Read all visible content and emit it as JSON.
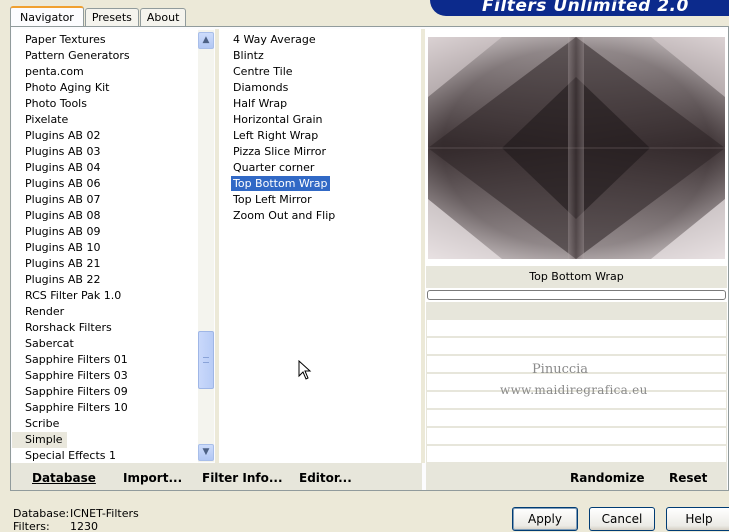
{
  "banner": {
    "title": "Filters Unlimited 2.0"
  },
  "tabs": [
    {
      "label": "Navigator",
      "active": true
    },
    {
      "label": "Presets",
      "active": false
    },
    {
      "label": "About",
      "active": false
    }
  ],
  "categories": {
    "items": [
      "Paper Textures",
      "Pattern Generators",
      "penta.com",
      "Photo Aging Kit",
      "Photo Tools",
      "Pixelate",
      "Plugins AB 02",
      "Plugins AB 03",
      "Plugins AB 04",
      "Plugins AB 06",
      "Plugins AB 07",
      "Plugins AB 08",
      "Plugins AB 09",
      "Plugins AB 10",
      "Plugins AB 21",
      "Plugins AB 22",
      "RCS Filter Pak 1.0",
      "Render",
      "Rorshack Filters",
      "Sabercat",
      "Sapphire Filters 01",
      "Sapphire Filters 03",
      "Sapphire Filters 09",
      "Sapphire Filters 10",
      "Scribe",
      "Simple",
      "Special Effects 1"
    ],
    "selected": "Simple"
  },
  "filters": {
    "items": [
      "4 Way Average",
      "Blintz",
      "Centre Tile",
      "Diamonds",
      "Half Wrap",
      "Horizontal Grain",
      "Left Right Wrap",
      "Pizza Slice Mirror",
      "Quarter corner",
      "Top Bottom Wrap",
      "Top Left Mirror",
      "Zoom Out and Flip"
    ],
    "selected": "Top Bottom Wrap"
  },
  "preview": {
    "filter_name": "Top Bottom Wrap"
  },
  "watermark": {
    "line1": "Pinuccia",
    "line2": "www.maidiregrafica.eu"
  },
  "toolbar": {
    "database_label": "Database",
    "import_label": "Import...",
    "filter_info_label": "Filter Info...",
    "editor_label": "Editor...",
    "randomize_label": "Randomize",
    "reset_label": "Reset"
  },
  "status": {
    "database_key": "Database:",
    "database_value": "ICNET-Filters",
    "filters_key": "Filters:",
    "filters_value": "1230"
  },
  "buttons": {
    "apply": "Apply",
    "cancel": "Cancel",
    "help": "Help"
  },
  "colors": {
    "selection": "#3169c6",
    "banner": "#0c2a8c",
    "tab_highlight": "#f0a030"
  }
}
